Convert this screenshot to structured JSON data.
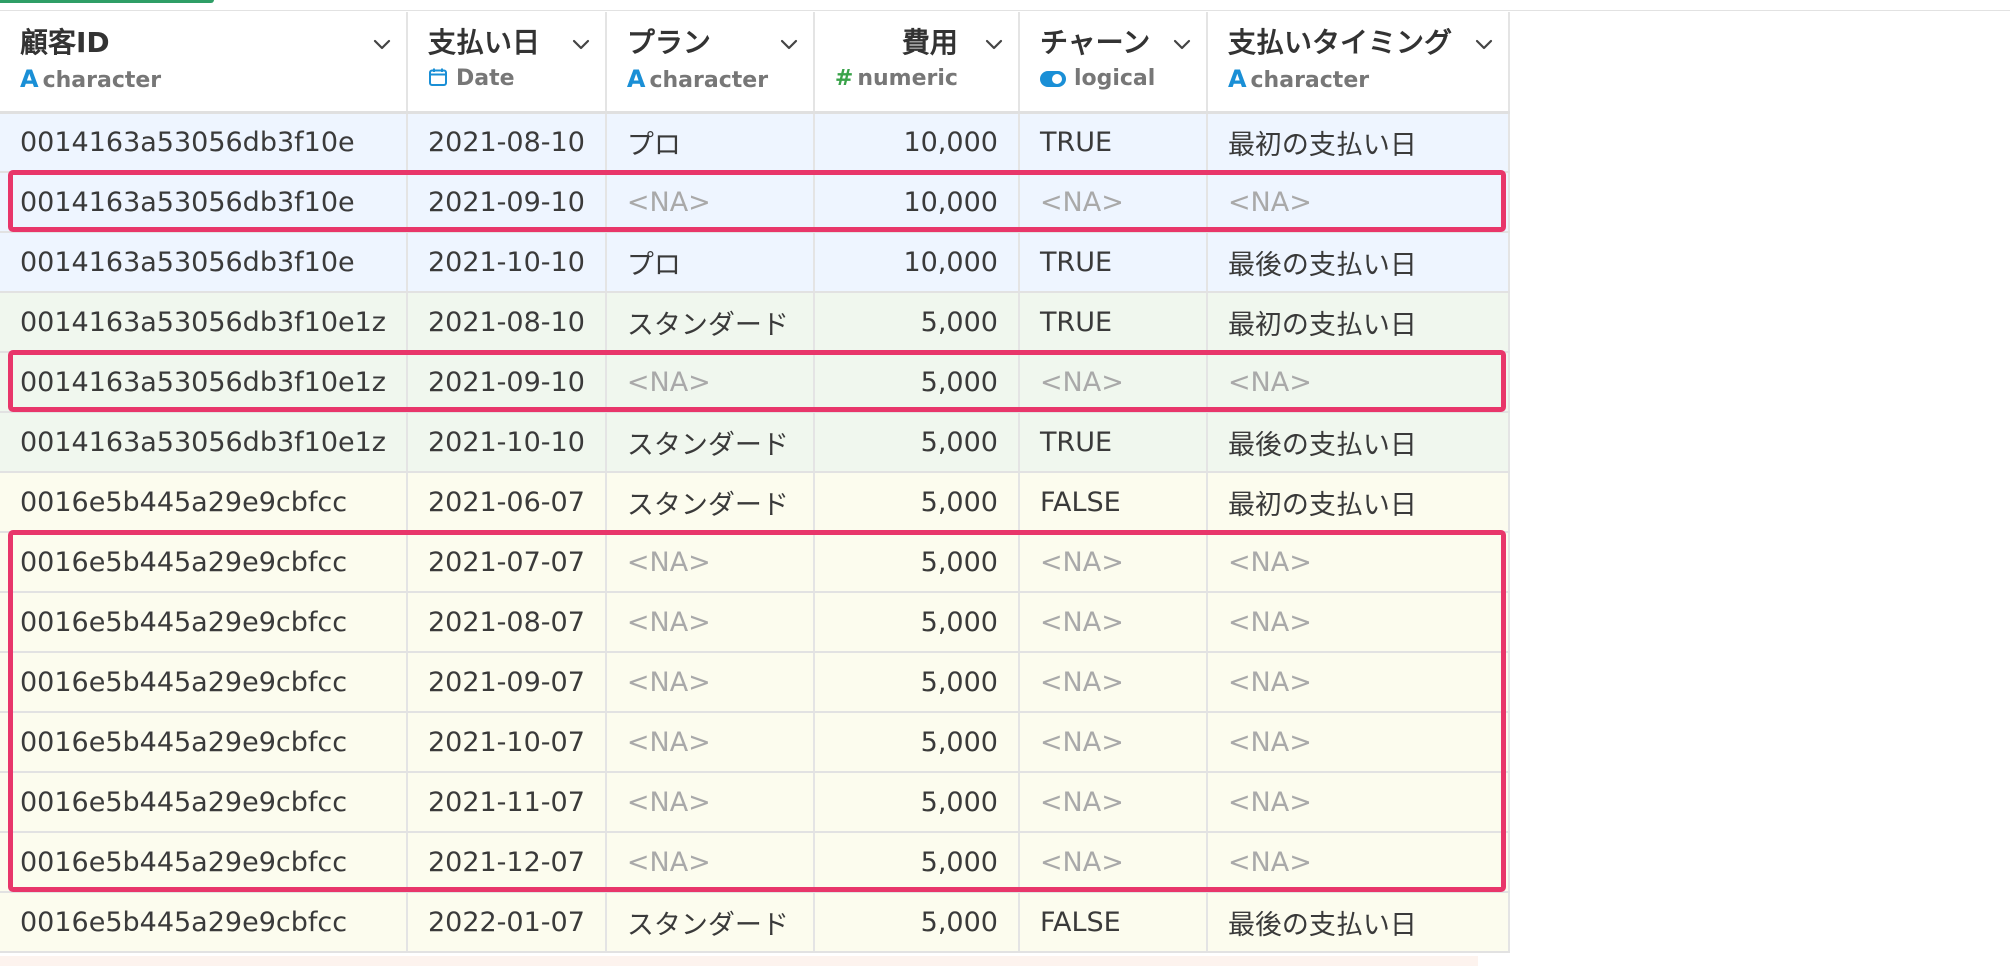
{
  "columns": [
    {
      "title": "顧客ID",
      "type": "character",
      "type_icon": "text-type-icon",
      "glyph": "A",
      "color": "#1a8fd6",
      "align": "left"
    },
    {
      "title": "支払い日",
      "type": "Date",
      "type_icon": "calendar-icon",
      "glyph": "",
      "color": "#1a8fd6",
      "align": "left"
    },
    {
      "title": "プラン",
      "type": "character",
      "type_icon": "text-type-icon",
      "glyph": "A",
      "color": "#1a8fd6",
      "align": "left"
    },
    {
      "title": "費用",
      "type": "numeric",
      "type_icon": "hash-icon",
      "glyph": "#",
      "color": "#3aa34a",
      "align": "right"
    },
    {
      "title": "チャーン",
      "type": "logical",
      "type_icon": "toggle-icon",
      "glyph": "",
      "color": "#1a8fd6",
      "align": "left"
    },
    {
      "title": "支払いタイミング",
      "type": "character",
      "type_icon": "text-type-icon",
      "glyph": "A",
      "color": "#1a8fd6",
      "align": "left"
    }
  ],
  "rows": [
    {
      "group": 0,
      "cells": [
        "0014163a53056db3f10e",
        "2021-08-10",
        "プロ",
        "10,000",
        "TRUE",
        "最初の支払い日"
      ]
    },
    {
      "group": 0,
      "cells": [
        "0014163a53056db3f10e",
        "2021-09-10",
        "<NA>",
        "10,000",
        "<NA>",
        "<NA>"
      ]
    },
    {
      "group": 0,
      "cells": [
        "0014163a53056db3f10e",
        "2021-10-10",
        "プロ",
        "10,000",
        "TRUE",
        "最後の支払い日"
      ]
    },
    {
      "group": 1,
      "cells": [
        "0014163a53056db3f10e1z",
        "2021-08-10",
        "スタンダード",
        "5,000",
        "TRUE",
        "最初の支払い日"
      ]
    },
    {
      "group": 1,
      "cells": [
        "0014163a53056db3f10e1z",
        "2021-09-10",
        "<NA>",
        "5,000",
        "<NA>",
        "<NA>"
      ]
    },
    {
      "group": 1,
      "cells": [
        "0014163a53056db3f10e1z",
        "2021-10-10",
        "スタンダード",
        "5,000",
        "TRUE",
        "最後の支払い日"
      ]
    },
    {
      "group": 2,
      "cells": [
        "0016e5b445a29e9cbfcc",
        "2021-06-07",
        "スタンダード",
        "5,000",
        "FALSE",
        "最初の支払い日"
      ]
    },
    {
      "group": 2,
      "cells": [
        "0016e5b445a29e9cbfcc",
        "2021-07-07",
        "<NA>",
        "5,000",
        "<NA>",
        "<NA>"
      ]
    },
    {
      "group": 2,
      "cells": [
        "0016e5b445a29e9cbfcc",
        "2021-08-07",
        "<NA>",
        "5,000",
        "<NA>",
        "<NA>"
      ]
    },
    {
      "group": 2,
      "cells": [
        "0016e5b445a29e9cbfcc",
        "2021-09-07",
        "<NA>",
        "5,000",
        "<NA>",
        "<NA>"
      ]
    },
    {
      "group": 2,
      "cells": [
        "0016e5b445a29e9cbfcc",
        "2021-10-07",
        "<NA>",
        "5,000",
        "<NA>",
        "<NA>"
      ]
    },
    {
      "group": 2,
      "cells": [
        "0016e5b445a29e9cbfcc",
        "2021-11-07",
        "<NA>",
        "5,000",
        "<NA>",
        "<NA>"
      ]
    },
    {
      "group": 2,
      "cells": [
        "0016e5b445a29e9cbfcc",
        "2021-12-07",
        "<NA>",
        "5,000",
        "<NA>",
        "<NA>"
      ]
    },
    {
      "group": 2,
      "cells": [
        "0016e5b445a29e9cbfcc",
        "2022-01-07",
        "スタンダード",
        "5,000",
        "FALSE",
        "最後の支払い日"
      ]
    }
  ],
  "highlights": [
    {
      "from_row": 1,
      "to_row": 1
    },
    {
      "from_row": 4,
      "to_row": 4
    },
    {
      "from_row": 7,
      "to_row": 12
    }
  ],
  "colors": {
    "highlight": "#e8366a",
    "na_text": "#a9a9a9",
    "accent": "#2e9e66"
  }
}
